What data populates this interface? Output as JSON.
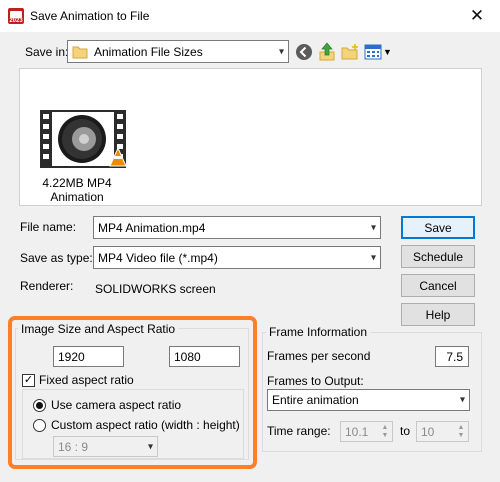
{
  "window": {
    "title": "Save Animation to File",
    "app_icon_text": "2023",
    "close_glyph": "✕"
  },
  "save_in": {
    "label": "Save in:",
    "folder": "Animation File Sizes"
  },
  "toolbar": {
    "back_icon": "back-icon",
    "up_icon": "up-folder-icon",
    "new_folder_icon": "new-folder-icon",
    "view_menu_icon": "view-menu-icon"
  },
  "files": [
    {
      "name": "4.22MB MP4 Animation",
      "line1": "4.22MB MP4",
      "line2": "Animation",
      "icon": "video-file-icon"
    }
  ],
  "file_name": {
    "label": "File name:",
    "value": "MP4 Animation.mp4"
  },
  "save_as_type": {
    "label": "Save as type:",
    "value": "MP4 Video file (*.mp4)"
  },
  "renderer": {
    "label": "Renderer:",
    "value": "SOLIDWORKS screen"
  },
  "buttons": {
    "save": "Save",
    "schedule": "Schedule",
    "cancel": "Cancel",
    "help": "Help"
  },
  "image_size": {
    "title": "Image Size and Aspect Ratio",
    "width": "1920",
    "height": "1080",
    "fixed_aspect_label": "Fixed aspect ratio",
    "fixed_aspect_checked": true,
    "use_camera_label": "Use camera aspect ratio",
    "custom_label": "Custom aspect ratio (width : height)",
    "selected_option": "use_camera",
    "custom_ratio_value": "16 : 9"
  },
  "frame_info": {
    "title": "Frame Information",
    "fps_label": "Frames per second",
    "fps_value": "7.5",
    "frames_output_label": "Frames to Output:",
    "frames_output_value": "Entire animation",
    "time_range_label": "Time range:",
    "time_from": "10.1",
    "to_label": "to",
    "time_to": "10"
  },
  "colors": {
    "highlight": "#ff7f27",
    "accent": "#0078d7",
    "app_icon": "#c0201a"
  }
}
